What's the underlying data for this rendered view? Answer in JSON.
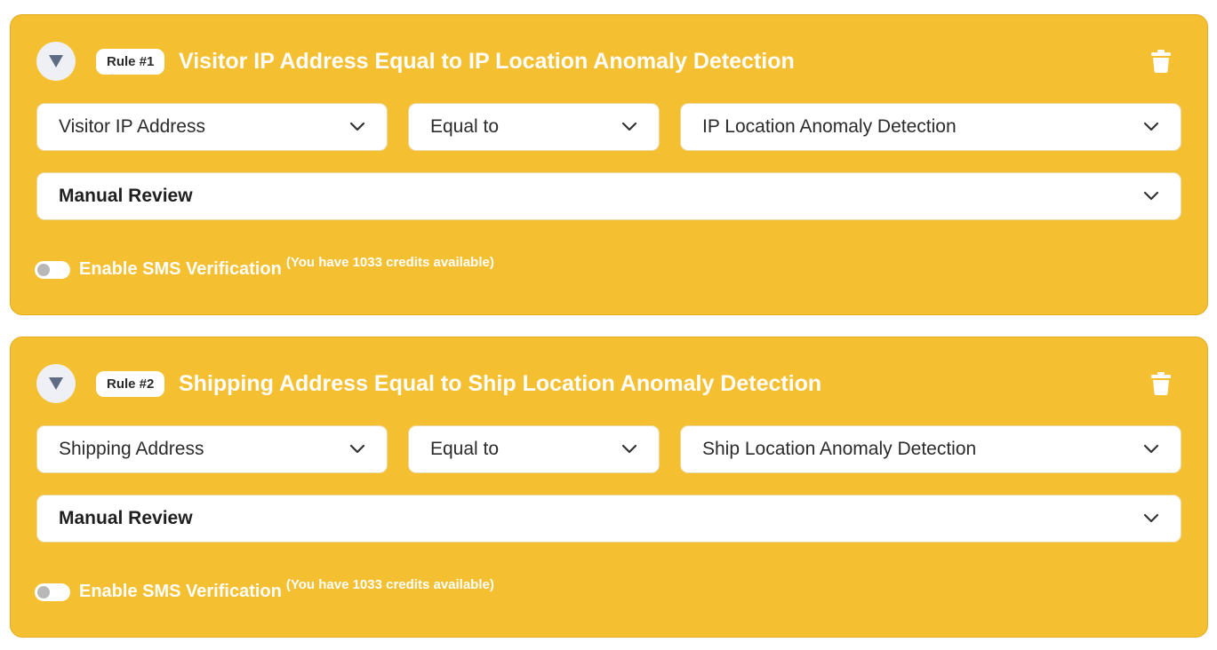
{
  "colors": {
    "card_background": "#f4bf30",
    "title_text": "#ffffff",
    "toggle_off_knob": "#b8b8b8",
    "collapse_button_bg": "#eef0f6",
    "collapse_icon": "#5d6b85"
  },
  "icons": {
    "collapse": "triangle-down-icon",
    "delete": "trash-icon",
    "select_arrow": "chevron-down-icon"
  },
  "rules": [
    {
      "badge": "Rule #1",
      "title": "Visitor IP Address Equal to IP Location Anomaly Detection",
      "field": "Visitor IP Address",
      "operator": "Equal to",
      "value": "IP Location Anomaly Detection",
      "action": "Manual Review",
      "sms_label": "Enable SMS Verification",
      "sms_credits": "(You have 1033 credits available)",
      "sms_enabled": false
    },
    {
      "badge": "Rule #2",
      "title": "Shipping Address Equal to Ship Location Anomaly Detection",
      "field": "Shipping Address",
      "operator": "Equal to",
      "value": "Ship Location Anomaly Detection",
      "action": "Manual Review",
      "sms_label": "Enable SMS Verification",
      "sms_credits": "(You have 1033 credits available)",
      "sms_enabled": false
    }
  ]
}
